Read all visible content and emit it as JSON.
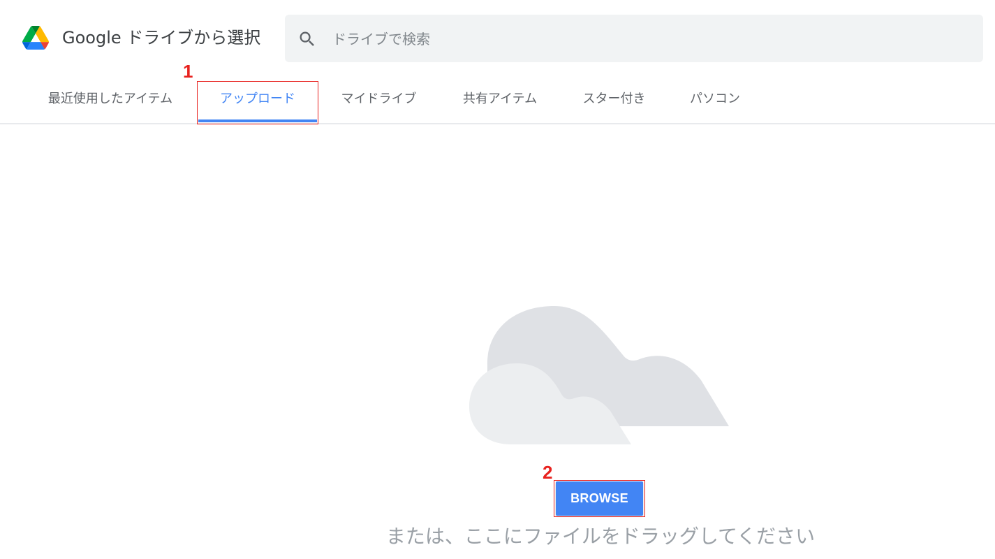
{
  "header": {
    "app_title": "Google ドライブから選択",
    "search_placeholder": "ドライブで検索"
  },
  "tabs": [
    {
      "label": "最近使用したアイテム",
      "active": false
    },
    {
      "label": "アップロード",
      "active": true
    },
    {
      "label": "マイドライブ",
      "active": false
    },
    {
      "label": "共有アイテム",
      "active": false
    },
    {
      "label": "スター付き",
      "active": false
    },
    {
      "label": "パソコン",
      "active": false
    }
  ],
  "annotations": {
    "step1": "1",
    "step2": "2"
  },
  "upload": {
    "browse_label": "BROWSE",
    "drag_text": "または、ここにファイルをドラッグしてください"
  },
  "colors": {
    "accent": "#4285f4",
    "highlight": "#e8211e",
    "cloud_back": "#dfe1e5",
    "cloud_front": "#eceef0"
  },
  "icons": {
    "logo": "google-drive-logo",
    "search": "search-icon"
  }
}
